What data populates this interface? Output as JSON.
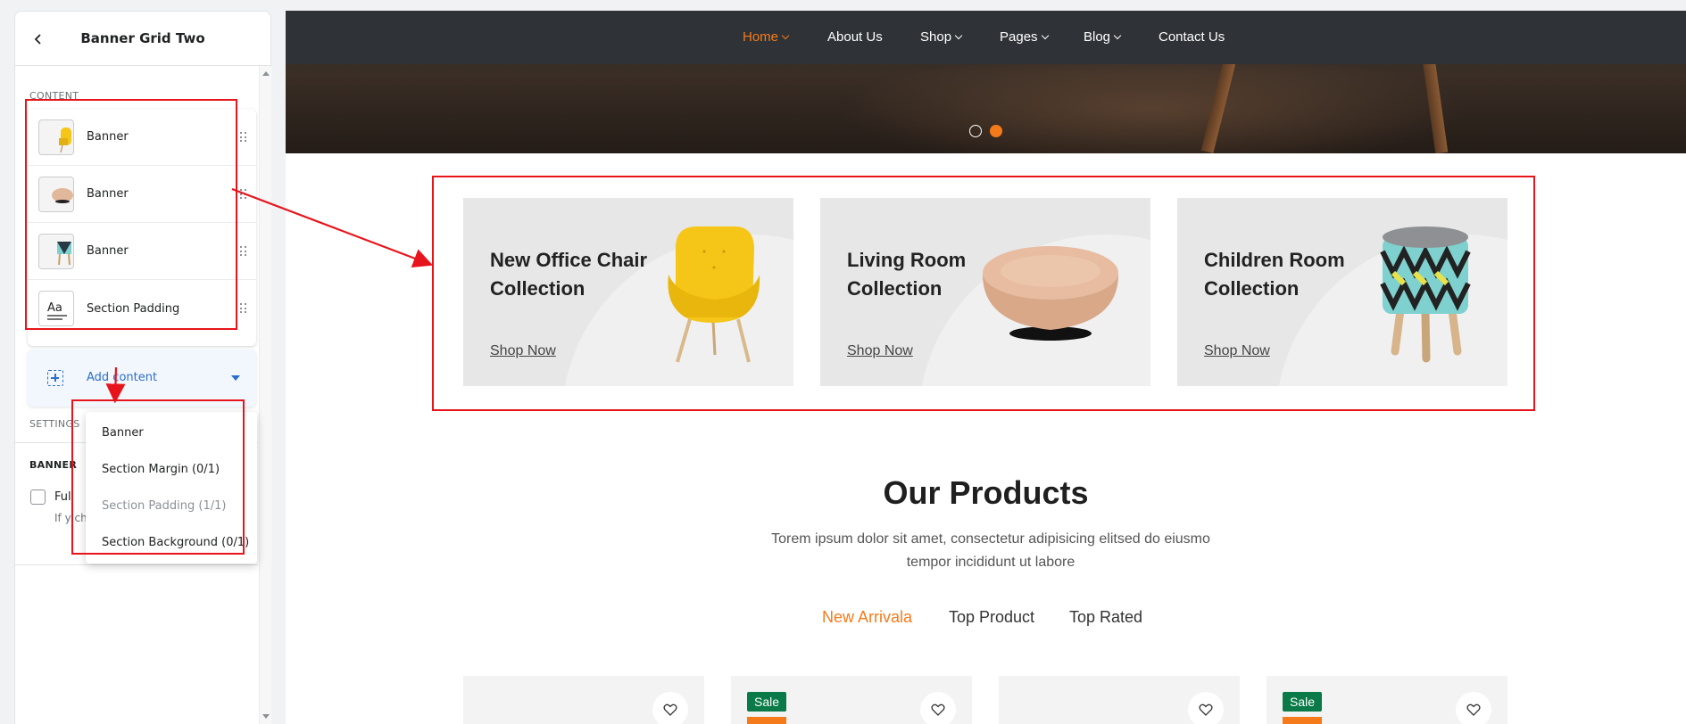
{
  "sidebar": {
    "title": "Banner Grid Two",
    "content_label": "CONTENT",
    "items": [
      {
        "label": "Banner",
        "thumb": "yellow-chair-thumbnail"
      },
      {
        "label": "Banner",
        "thumb": "ottoman-thumbnail"
      },
      {
        "label": "Banner",
        "thumb": "stool-thumbnail"
      },
      {
        "label": "Section Padding",
        "thumb": "text-format-icon"
      }
    ],
    "add_content": "Add content",
    "settings_label": "SETTINGS",
    "banner_label": "BANNER",
    "checkbox_label": "Ful",
    "checkbox_help": "If y che",
    "dropdown": [
      {
        "label": "Banner",
        "disabled": false
      },
      {
        "label": "Section Margin (0/1)",
        "disabled": false
      },
      {
        "label": "Section Padding (1/1)",
        "disabled": true
      },
      {
        "label": "Section Background (0/1)",
        "disabled": false
      }
    ]
  },
  "nav": {
    "items": [
      {
        "label": "Home",
        "caret": true,
        "active": true
      },
      {
        "label": "About Us",
        "caret": false,
        "active": false
      },
      {
        "label": "Shop",
        "caret": true,
        "active": false
      },
      {
        "label": "Pages",
        "caret": true,
        "active": false
      },
      {
        "label": "Blog",
        "caret": true,
        "active": false
      },
      {
        "label": "Contact Us",
        "caret": false,
        "active": false
      }
    ],
    "accent": "#f57a1a",
    "background": "#2f3337"
  },
  "banners": [
    {
      "title": "New Office Chair Collection",
      "link": "Shop Now",
      "image": "yellow-armchair"
    },
    {
      "title": "Living Room Collection",
      "link": "Shop Now",
      "image": "round-ottoman"
    },
    {
      "title": "Children Room Collection",
      "link": "Shop Now",
      "image": "patterned-stool"
    }
  ],
  "products": {
    "title": "Our Products",
    "subtitle": "Torem ipsum dolor sit amet, consectetur adipisicing elitsed do eiusmo tempor incididunt ut labore",
    "tabs": [
      {
        "label": "New Arrivala",
        "active": true
      },
      {
        "label": "Top Product",
        "active": false
      },
      {
        "label": "Top Rated",
        "active": false
      }
    ],
    "cards": [
      {
        "badge": ""
      },
      {
        "badge": "Sale"
      },
      {
        "badge": ""
      },
      {
        "badge": "Sale"
      }
    ]
  },
  "colors": {
    "annotation": "#e8141b",
    "sale_badge": "#0a7a48",
    "link_blue": "#2c6ecb"
  }
}
